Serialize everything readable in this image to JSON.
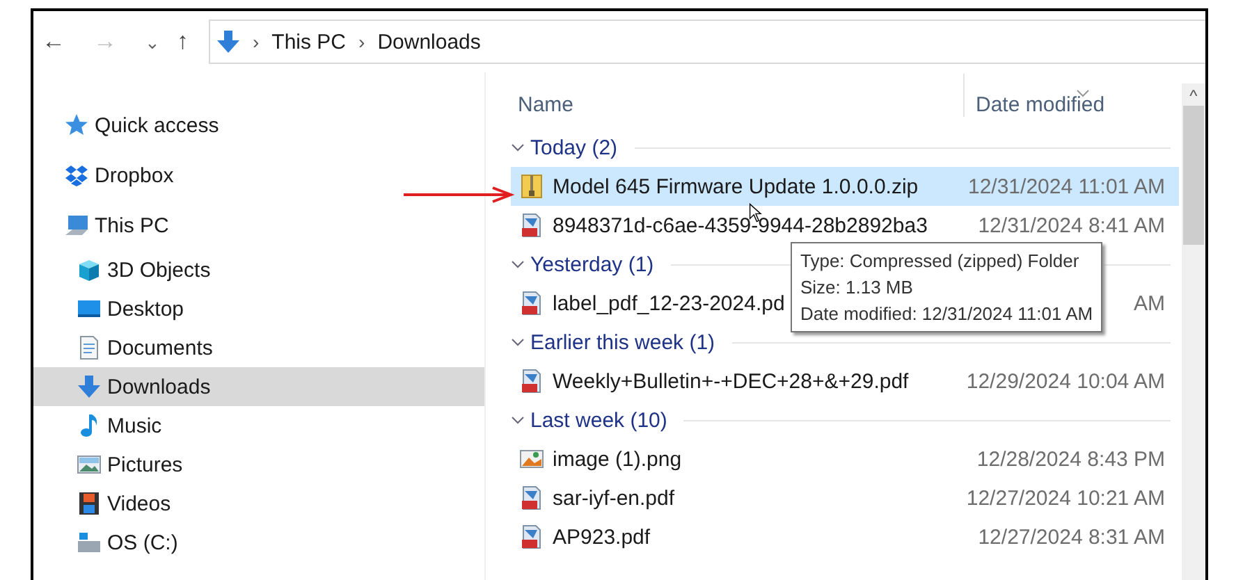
{
  "toolbar": {
    "back": "←",
    "forward": "→",
    "recent": "⌄",
    "up": "↑"
  },
  "address": {
    "crumbs": [
      {
        "label": "This PC"
      },
      {
        "label": "Downloads"
      }
    ],
    "separator": "›"
  },
  "sidebar": {
    "items": [
      {
        "label": "Quick access",
        "kind": "star",
        "selected": false
      },
      {
        "label": "Dropbox",
        "kind": "dropbox",
        "selected": false
      },
      {
        "label": "This PC",
        "kind": "pc",
        "selected": false,
        "children": [
          {
            "label": "3D Objects",
            "kind": "cube",
            "selected": false
          },
          {
            "label": "Desktop",
            "kind": "desktop",
            "selected": false
          },
          {
            "label": "Documents",
            "kind": "document",
            "selected": false
          },
          {
            "label": "Downloads",
            "kind": "download",
            "selected": true
          },
          {
            "label": "Music",
            "kind": "music",
            "selected": false
          },
          {
            "label": "Pictures",
            "kind": "pictures",
            "selected": false
          },
          {
            "label": "Videos",
            "kind": "videos",
            "selected": false
          },
          {
            "label": "OS (C:)",
            "kind": "drive",
            "selected": false
          }
        ]
      }
    ]
  },
  "table": {
    "columns": [
      {
        "label": "Name"
      },
      {
        "label": "Date modified",
        "sorted": true
      }
    ],
    "groups": [
      {
        "label": "Today (2)",
        "expanded": true,
        "rows": [
          {
            "name": "Model 645 Firmware Update 1.0.0.0.zip",
            "date": "12/31/2024 11:01 AM",
            "kind": "zip",
            "selected": true
          },
          {
            "name": "8948371d-c6ae-4359-9944-28b2892ba3",
            "date": "12/31/2024 8:41 AM",
            "kind": "pdf",
            "selected": false
          }
        ]
      },
      {
        "label": "Yesterday (1)",
        "expanded": true,
        "rows": [
          {
            "name": "label_pdf_12-23-2024.pd",
            "date": "AM",
            "kind": "pdf",
            "selected": false
          }
        ]
      },
      {
        "label": "Earlier this week (1)",
        "expanded": true,
        "rows": [
          {
            "name": "Weekly+Bulletin+-+DEC+28+&+29.pdf",
            "date": "12/29/2024 10:04 AM",
            "kind": "pdf",
            "selected": false
          }
        ]
      },
      {
        "label": "Last week (10)",
        "expanded": true,
        "rows": [
          {
            "name": "image (1).png",
            "date": "12/28/2024 8:43 PM",
            "kind": "image",
            "selected": false
          },
          {
            "name": "sar-iyf-en.pdf",
            "date": "12/27/2024 10:21 AM",
            "kind": "pdf",
            "selected": false
          },
          {
            "name": "AP923.pdf",
            "date": "12/27/2024 8:31 AM",
            "kind": "pdf",
            "selected": false
          }
        ]
      }
    ]
  },
  "tooltip": {
    "lines": [
      "Type: Compressed (zipped) Folder",
      "Size: 1.13 MB",
      "Date modified: 12/31/2024 11:01 AM"
    ]
  },
  "scrollbar": {
    "up": "^"
  }
}
